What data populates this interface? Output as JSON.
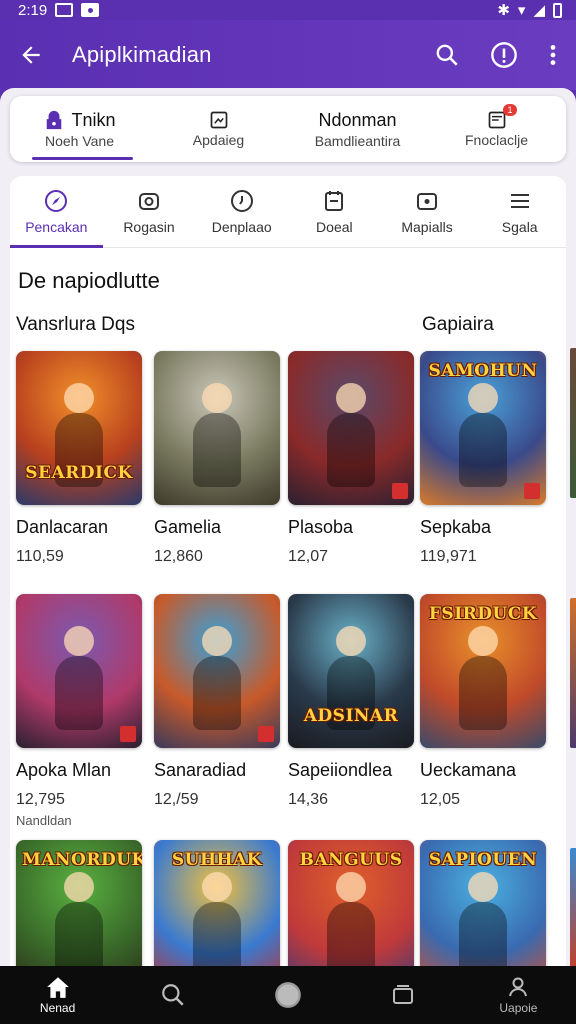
{
  "status_bar": {
    "time": "2:19"
  },
  "app_bar": {
    "title": "Apiplkimadian",
    "back_icon": "back-arrow-icon",
    "actions": [
      "search-icon",
      "info-icon",
      "more-vert-icon"
    ]
  },
  "top_tabs": [
    {
      "title": "Tnikn",
      "subtitle": "Noeh Vane",
      "icon": "user-icon",
      "active": true
    },
    {
      "title": "",
      "subtitle": "Apdaieg",
      "icon": "image-icon",
      "active": false
    },
    {
      "title": "Ndonman",
      "subtitle": "Bamdlieantira",
      "icon": "",
      "active": false
    },
    {
      "title": "",
      "subtitle": "Fnoclaclje",
      "icon": "inbox-icon",
      "active": false,
      "badge": "1"
    }
  ],
  "categories": [
    {
      "label": "Pencakan",
      "icon": "compass-icon",
      "active": true
    },
    {
      "label": "Rogasin",
      "icon": "camera-icon",
      "active": false
    },
    {
      "label": "Denplaao",
      "icon": "clock-icon",
      "active": false
    },
    {
      "label": "Doeal",
      "icon": "calendar-icon",
      "active": false
    },
    {
      "label": "Mapialls",
      "icon": "photo-icon",
      "active": false
    },
    {
      "label": "Sgala",
      "icon": "menu-icon",
      "active": false
    }
  ],
  "section": {
    "title": "De napiodlutte",
    "left_label": "Vansrlura Dqs",
    "right_label": "Gapiaira"
  },
  "games": [
    {
      "name": "Danlacaran",
      "count": "110,59",
      "logo": "SEARDICK",
      "logo_pos": "bottom",
      "colors": [
        "#f0902a",
        "#b8401e",
        "#2a3a6a"
      ]
    },
    {
      "name": "Gamelia",
      "count": "12,860",
      "logo": "",
      "logo_pos": "none",
      "colors": [
        "#c9c6b8",
        "#7a7a60",
        "#3d3a2a"
      ]
    },
    {
      "name": "Plasoba",
      "count": "12,07",
      "logo": "",
      "logo_pos": "none",
      "colors": [
        "#5a4a6a",
        "#8a2a2a",
        "#2a2030"
      ]
    },
    {
      "name": "Sepkaba",
      "count": "119,971",
      "logo": "SAMOHUN",
      "logo_pos": "top",
      "colors": [
        "#4aa0d8",
        "#3a4a8a",
        "#d87a2a"
      ]
    },
    {
      "name": "Apoka Mlan",
      "count": "12,795",
      "extra": "Nandldan",
      "logo": "",
      "logo_pos": "none",
      "colors": [
        "#7a5ab0",
        "#b03a6a",
        "#2a2030"
      ]
    },
    {
      "name": "Sanaradiad",
      "count": "12,/59",
      "logo": "",
      "logo_pos": "none",
      "colors": [
        "#3aa0d8",
        "#c85a2a",
        "#3a3a5a"
      ]
    },
    {
      "name": "Sapeiiondlea",
      "count": "14,36",
      "logo": "ADSINAR",
      "logo_pos": "bottom",
      "colors": [
        "#6ab0c8",
        "#2a3a4a",
        "#1a1a20"
      ]
    },
    {
      "name": "Ueckamana",
      "count": "12,05",
      "logo": "FSIRDUCK",
      "logo_pos": "top",
      "colors": [
        "#e8902a",
        "#c04a2a",
        "#3a4a6a"
      ]
    },
    {
      "name": "",
      "count": "",
      "logo": "MANORDUK",
      "logo_pos": "top",
      "colors": [
        "#5ab040",
        "#3a6a2a",
        "#2a2a1a"
      ]
    },
    {
      "name": "",
      "count": "",
      "logo": "SUHHAK",
      "logo_pos": "top",
      "colors": [
        "#f0c040",
        "#3a7ad0",
        "#c0302a"
      ]
    },
    {
      "name": "",
      "count": "",
      "logo": "BANGUUS",
      "logo_pos": "top",
      "colors": [
        "#e0602a",
        "#c03a3a",
        "#3a3a7a"
      ]
    },
    {
      "name": "",
      "count": "",
      "logo": "SAPIOUEN",
      "logo_pos": "top",
      "colors": [
        "#4ab0e0",
        "#3a6ab0",
        "#d0502a"
      ]
    }
  ],
  "bottom_nav": [
    {
      "label": "Nenad",
      "icon": "home-icon",
      "active": true
    },
    {
      "label": "",
      "icon": "search-icon",
      "active": false
    },
    {
      "label": "",
      "icon": "circle-icon",
      "active": false
    },
    {
      "label": "",
      "icon": "square-icon",
      "active": false
    },
    {
      "label": "Uapoie",
      "icon": "person-icon",
      "active": false
    }
  ],
  "accent_color": "#5b2fb2"
}
